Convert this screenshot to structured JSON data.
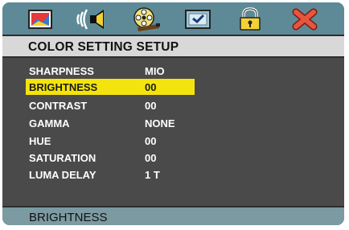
{
  "tabs": [
    {
      "name": "picture-tab",
      "icon": "picture-icon"
    },
    {
      "name": "audio-tab",
      "icon": "speaker-icon"
    },
    {
      "name": "video-tab",
      "icon": "film-reel-icon"
    },
    {
      "name": "preference-tab",
      "icon": "checkbox-icon"
    },
    {
      "name": "lock-tab",
      "icon": "padlock-icon"
    },
    {
      "name": "exit-tab",
      "icon": "close-icon"
    }
  ],
  "header": {
    "title": "COLOR SETTING SETUP"
  },
  "menu": {
    "items": [
      {
        "label": "SHARPNESS",
        "value": "MIO"
      },
      {
        "label": "BRIGHTNESS",
        "value": "00",
        "selected": true
      },
      {
        "label": "CONTRAST",
        "value": "00"
      },
      {
        "label": "GAMMA",
        "value": "NONE"
      },
      {
        "label": "HUE",
        "value": "00"
      },
      {
        "label": "SATURATION",
        "value": "00"
      },
      {
        "label": "LUMA DELAY",
        "value": "1 T"
      }
    ]
  },
  "status": {
    "text": "BRIGHTNESS"
  },
  "colors": {
    "tab_bar": "#5d8a96",
    "body": "#4a4a4a",
    "highlight": "#f4e40d",
    "status_bar": "#7c9aa2"
  }
}
